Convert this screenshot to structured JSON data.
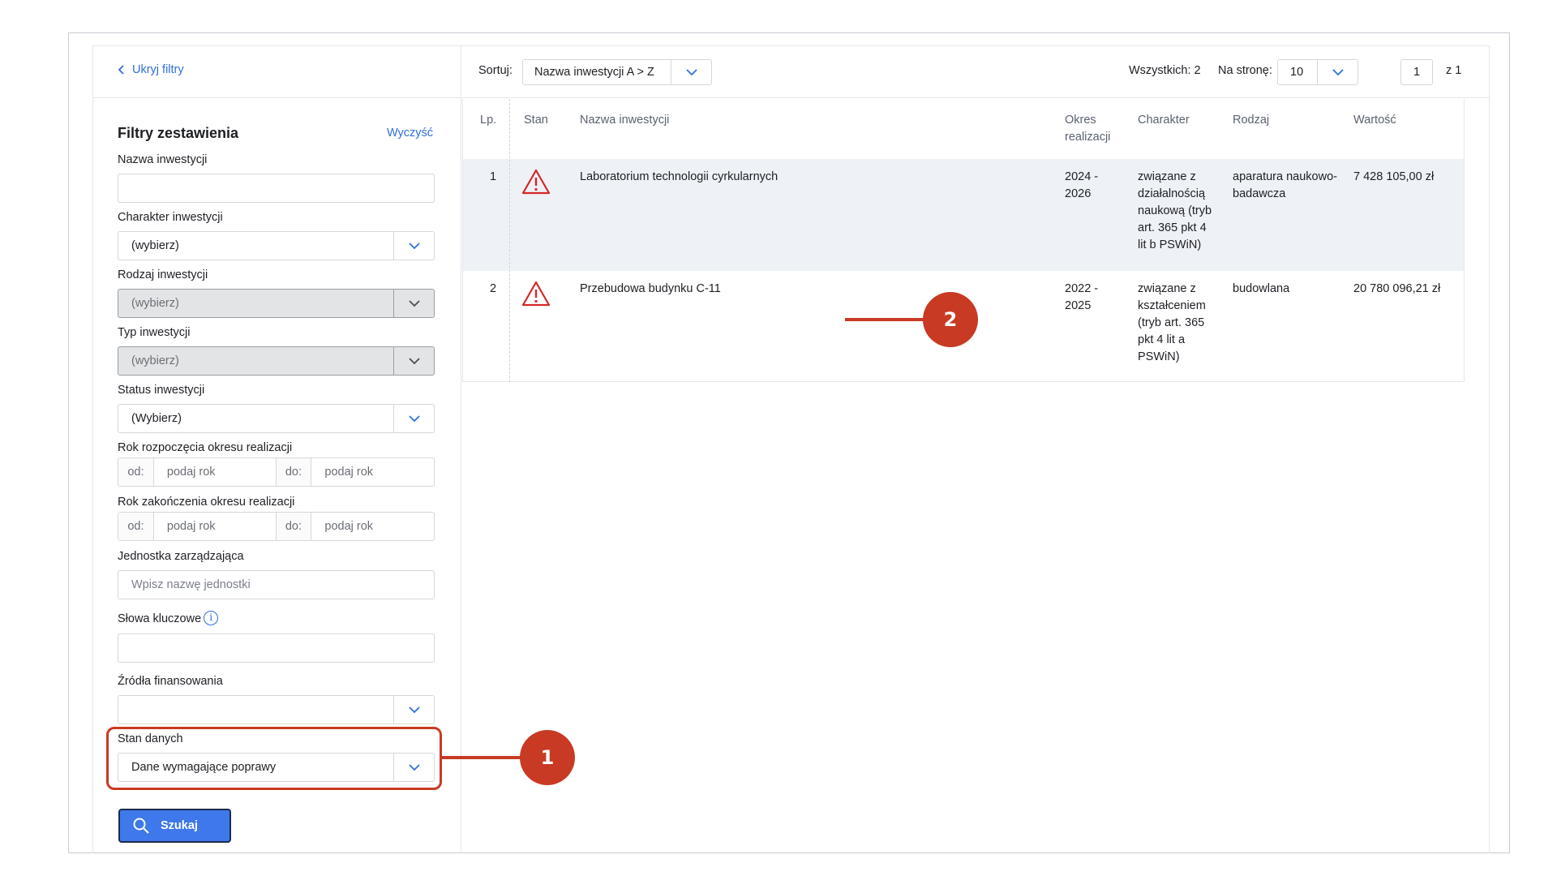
{
  "sidebar": {
    "hide_filters": "Ukryj filtry",
    "title": "Filtry zestawienia",
    "clear": "Wyczyść",
    "fields": {
      "name_label": "Nazwa inwestycji",
      "character_label": "Charakter inwestycji",
      "character_value": "(wybierz)",
      "kind_label": "Rodzaj inwestycji",
      "kind_value": "(wybierz)",
      "type_label": "Typ inwestycji",
      "type_value": "(wybierz)",
      "status_label": "Status inwestycji",
      "status_value": "(Wybierz)",
      "start_label": "Rok rozpoczęcia okresu realizacji",
      "end_label": "Rok zakończenia okresu realizacji",
      "from": "od:",
      "to": "do:",
      "year_placeholder": "podaj rok",
      "unit_label": "Jednostka zarządzająca",
      "unit_placeholder": "Wpisz nazwę jednostki",
      "keywords_label": "Słowa kluczowe",
      "funding_label": "Źródła finansowania",
      "data_state_label": "Stan danych",
      "data_state_value": "Dane wymagające poprawy"
    },
    "search_button": "Szukaj"
  },
  "toolbar": {
    "sort_label": "Sortuj:",
    "sort_value": "Nazwa inwestycji A > Z",
    "total": "Wszystkich: 2",
    "per_page_label": "Na stronę:",
    "per_page_value": "10",
    "page_value": "1",
    "page_of": "z  1"
  },
  "table": {
    "headers": {
      "lp": "Lp.",
      "state": "Stan",
      "name": "Nazwa inwestycji",
      "period_1": "Okres",
      "period_2": "realizacji",
      "character": "Charakter",
      "kind": "Rodzaj",
      "value": "Wartość"
    },
    "rows": [
      {
        "lp": "1",
        "state_icon": "warning-triangle-icon",
        "name": "Laboratorium technologii cyrkularnych",
        "period_1": "2024 -",
        "period_2": "2026",
        "character": [
          "związane z",
          "działalnością",
          "naukową (tryb",
          "art. 365 pkt 4",
          "lit b PSWiN)"
        ],
        "kind": [
          "aparatura naukowo-",
          "badawcza"
        ],
        "value": "7 428 105,00 zł"
      },
      {
        "lp": "2",
        "state_icon": "warning-triangle-icon",
        "name": "Przebudowa budynku C-11",
        "period_1": "2022 -",
        "period_2": "2025",
        "character": [
          "związane z",
          "kształceniem",
          "(tryb art. 365",
          "pkt 4 lit a",
          "PSWiN)"
        ],
        "kind": [
          "budowlana"
        ],
        "value": "20 780 096,21 zł"
      }
    ]
  },
  "callouts": {
    "one": "1",
    "two": "2"
  },
  "colors": {
    "accent": "#2f6fdc",
    "callout": "#c83a24",
    "button": "#3f78ea",
    "warning": "#d62828"
  }
}
